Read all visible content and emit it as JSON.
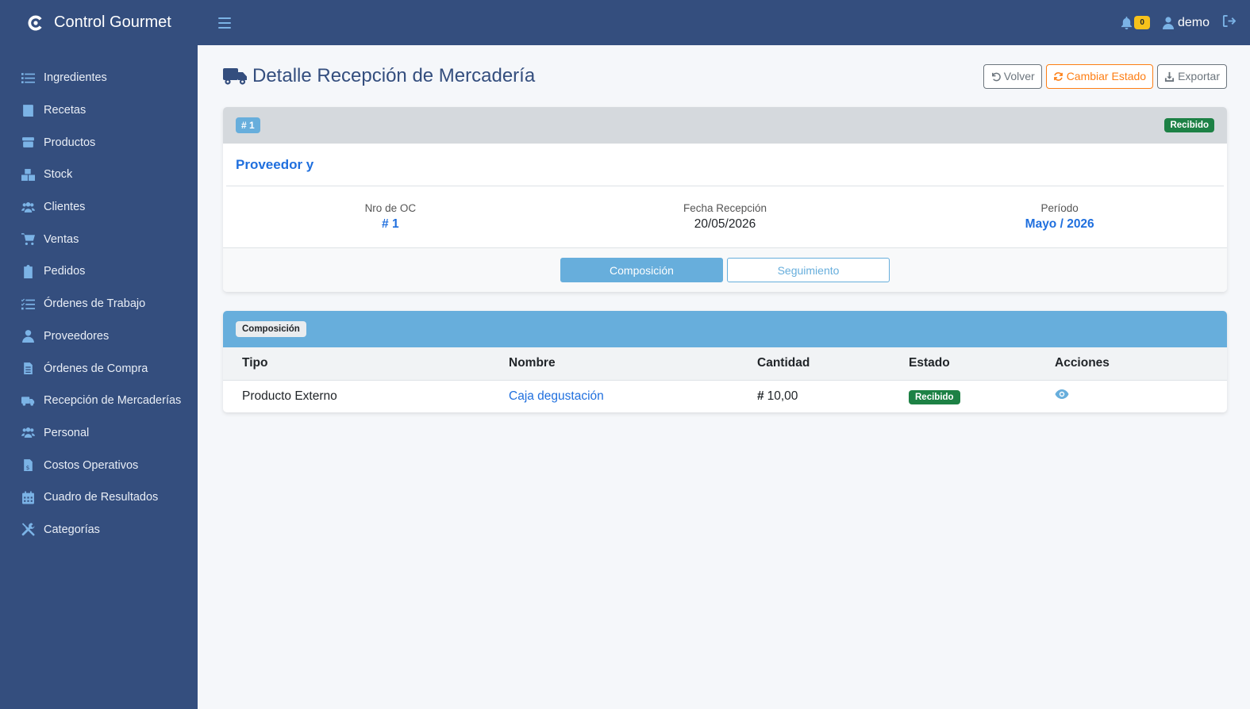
{
  "app": {
    "name": "Control Gourmet"
  },
  "sidebar": {
    "items": [
      {
        "label": "Ingredientes",
        "icon": "list-icon"
      },
      {
        "label": "Recetas",
        "icon": "book-icon"
      },
      {
        "label": "Productos",
        "icon": "box-icon"
      },
      {
        "label": "Stock",
        "icon": "boxes-icon"
      },
      {
        "label": "Clientes",
        "icon": "users-icon"
      },
      {
        "label": "Ventas",
        "icon": "cart-icon"
      },
      {
        "label": "Pedidos",
        "icon": "clipboard-icon"
      },
      {
        "label": "Órdenes de Trabajo",
        "icon": "tasks-icon"
      },
      {
        "label": "Proveedores",
        "icon": "user-tie-icon"
      },
      {
        "label": "Órdenes de Compra",
        "icon": "file-icon"
      },
      {
        "label": "Recepción de Mercaderías",
        "icon": "truck-icon"
      },
      {
        "label": "Personal",
        "icon": "users-icon"
      },
      {
        "label": "Costos Operativos",
        "icon": "invoice-icon"
      },
      {
        "label": "Cuadro de Resultados",
        "icon": "calendar-icon"
      },
      {
        "label": "Categorías",
        "icon": "tools-icon"
      }
    ]
  },
  "topbar": {
    "notifications": "0",
    "user": "demo"
  },
  "page": {
    "title": "Detalle Recepción de Mercadería",
    "buttons": {
      "back": "Volver",
      "change_status": "Cambiar Estado",
      "export": "Exportar"
    }
  },
  "detail": {
    "id": "# 1",
    "status": "Recibido",
    "supplier": "Proveedor y",
    "order_label": "Nro de OC",
    "order_value": "1",
    "date_label": "Fecha Recepción",
    "date_value": "20/05/2026",
    "period_label": "Período",
    "period_value": "Mayo / 2026",
    "tabs": [
      "Composición",
      "Seguimiento"
    ]
  },
  "composition": {
    "badge": "Composición",
    "columns": [
      "Tipo",
      "Nombre",
      "Cantidad",
      "Estado",
      "Acciones"
    ],
    "rows": [
      {
        "tipo": "Producto Externo",
        "nombre": "Caja degustación",
        "cantidad": "10,00",
        "estado": "Recibido"
      }
    ]
  },
  "colors": {
    "sidebar": "#344e7e",
    "accent": "#67aedc",
    "success": "#1d8145",
    "warning": "#fd7e14",
    "link": "#1f6fde"
  }
}
